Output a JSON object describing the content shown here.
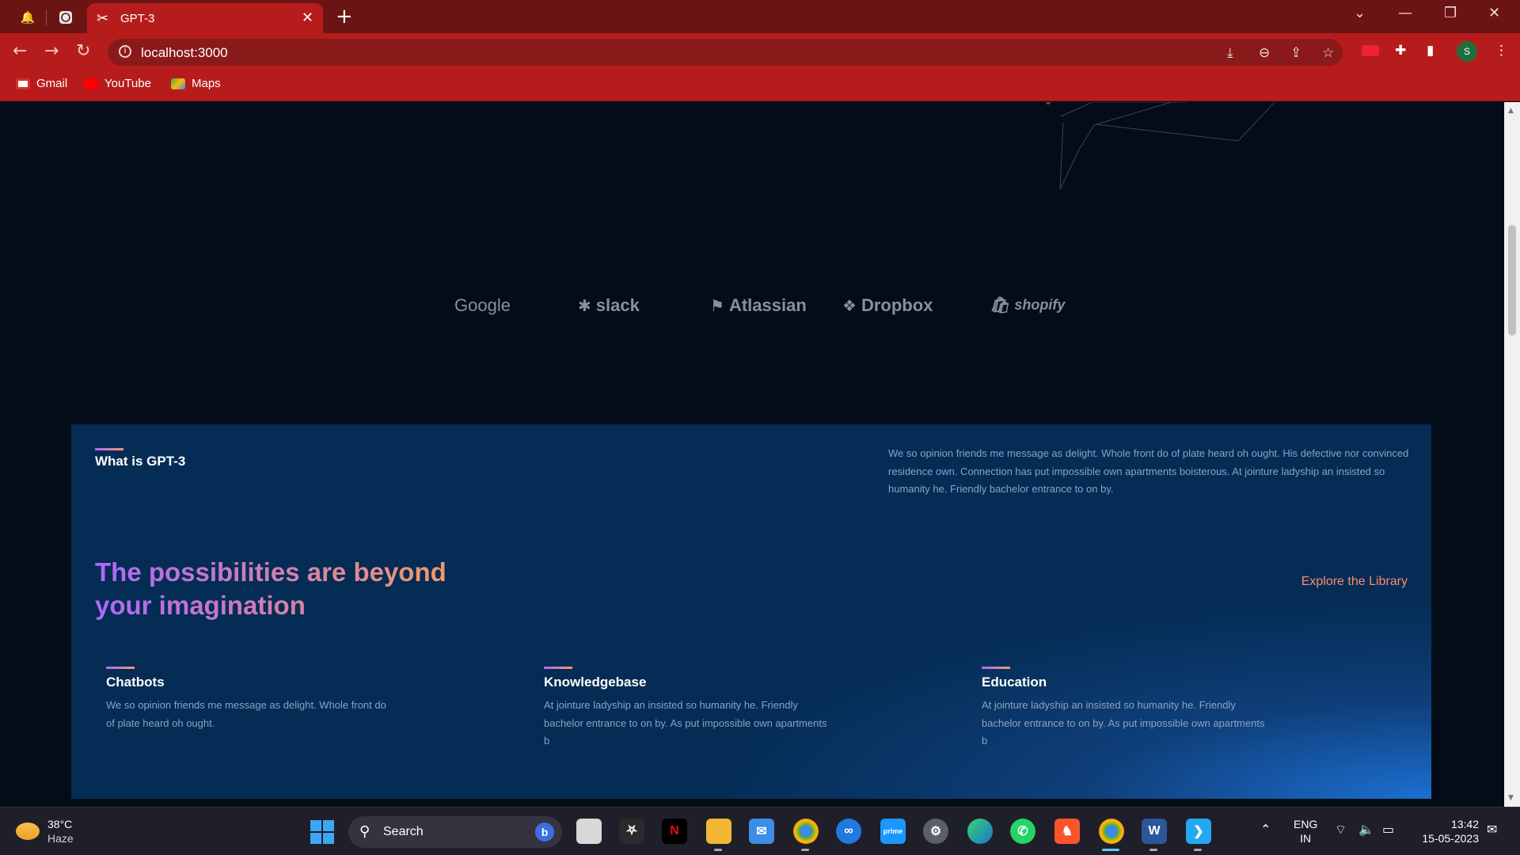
{
  "browser": {
    "tab_title": "GPT-3",
    "url": "localhost:3000",
    "profile_initial": "S",
    "bookmarks": [
      {
        "label": "Gmail"
      },
      {
        "label": "YouTube"
      },
      {
        "label": "Maps"
      }
    ]
  },
  "brands": [
    "Google",
    "slack",
    "Atlassian",
    "Dropbox",
    "shopify"
  ],
  "what_gpt": {
    "heading": "What is GPT-3",
    "description": "We so opinion friends me message as delight. Whole front do of plate heard oh ought. His defective nor convinced residence own. Connection has put impossible own apartments boisterous. At jointure ladyship an insisted so humanity he. Friendly bachelor entrance to on by.",
    "title": "The possibilities are beyond your imagination",
    "explore_label": "Explore the Library",
    "features": [
      {
        "title": "Chatbots",
        "text": "We so opinion friends me message as delight. Whole front do of plate heard oh ought."
      },
      {
        "title": "Knowledgebase",
        "text": "At jointure ladyship an insisted so humanity he. Friendly bachelor entrance to on by. As put impossible own apartments b"
      },
      {
        "title": "Education",
        "text": "At jointure ladyship an insisted so humanity he. Friendly bachelor entrance to on by. As put impossible own apartments b"
      }
    ]
  },
  "taskbar": {
    "weather_temp": "38°C",
    "weather_desc": "Haze",
    "search_label": "Search",
    "lang_top": "ENG",
    "lang_bottom": "IN",
    "time": "13:42",
    "date": "15-05-2023"
  },
  "colors": {
    "page_bg": "#040C18",
    "section_bg": "#042C54",
    "gradient_start": "#AE67FA",
    "gradient_end": "#F49867",
    "explore_link": "#FF8A71",
    "browser_red": "#B71C1C"
  }
}
